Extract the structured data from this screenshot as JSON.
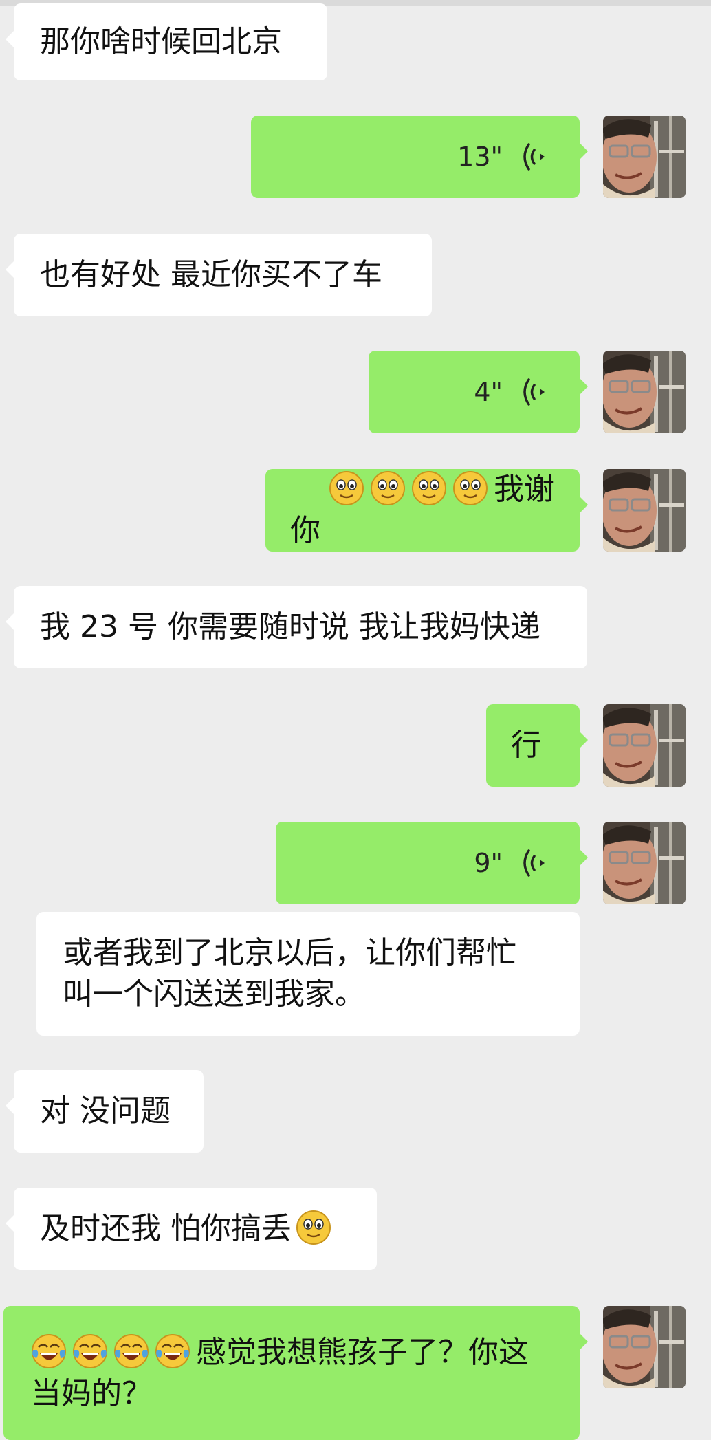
{
  "messages": [
    {
      "side": "in",
      "text": "那你啥时候回北京"
    },
    {
      "side": "out",
      "voice": "13\""
    },
    {
      "side": "in",
      "text": "也有好处 最近你买不了车"
    },
    {
      "side": "out",
      "voice": "4\""
    },
    {
      "side": "out",
      "text": "我谢你",
      "emoji": [
        "smile-emoji",
        "smile-emoji",
        "smile-emoji",
        "smile-emoji"
      ]
    },
    {
      "side": "in",
      "text": "我 23 号 你需要随时说 我让我妈快递"
    },
    {
      "side": "out",
      "text": "行"
    },
    {
      "side": "out",
      "voice": "9\""
    },
    {
      "side": "in",
      "text": "或者我到了北京以后，让你们帮忙\n叫一个闪送送到我家。"
    },
    {
      "side": "in",
      "text": "对 没问题"
    },
    {
      "side": "in",
      "text": "及时还我 怕你搞丢",
      "emoji_after": "smile-emoji"
    },
    {
      "side": "out",
      "text": "感觉我想熊孩子了？你这\n当妈的？",
      "emoji": [
        "tears-of-joy-emoji",
        "tears-of-joy-emoji",
        "tears-of-joy-emoji",
        "tears-of-joy-emoji"
      ]
    }
  ],
  "colors": {
    "background": "#ededed",
    "incoming": "#ffffff",
    "outgoing": "#95ec69"
  }
}
